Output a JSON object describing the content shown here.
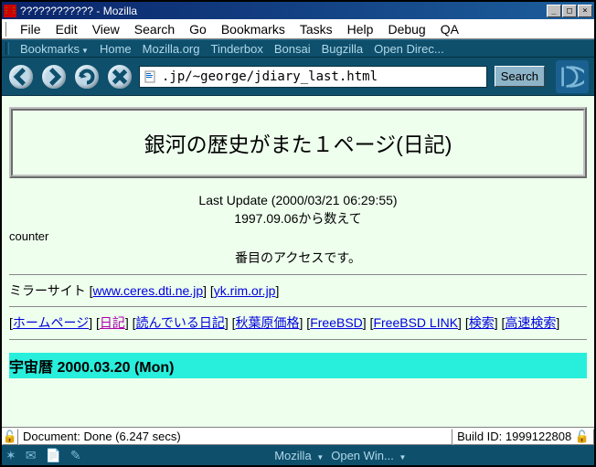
{
  "title": "???????????? - Mozilla",
  "menubar": [
    "File",
    "Edit",
    "View",
    "Search",
    "Go",
    "Bookmarks",
    "Tasks",
    "Help",
    "Debug",
    "QA"
  ],
  "bookmarkbar": [
    {
      "label": "Bookmarks",
      "dropdown": true
    },
    {
      "label": "Home"
    },
    {
      "label": "Mozilla.org"
    },
    {
      "label": "Tinderbox"
    },
    {
      "label": "Bonsai"
    },
    {
      "label": "Bugzilla"
    },
    {
      "label": "Open Direc..."
    }
  ],
  "url": ".jp/~george/jdiary_last.html",
  "search_label": "Search",
  "page": {
    "heading": "銀河の歴史がまた１ページ(日記)",
    "last_update": "Last Update (2000/03/21 06:29:55)",
    "since": "1997.09.06から数えて",
    "counter_label": "counter",
    "access_text": "番目のアクセスです。",
    "mirror_label": "ミラーサイト",
    "mirrors": [
      "www.ceres.dti.ne.jp",
      "yk.rim.or.jp"
    ],
    "navlinks": [
      {
        "t": "ホームページ",
        "v": false
      },
      {
        "t": "日記",
        "v": true
      },
      {
        "t": "読んでいる日記",
        "v": false
      },
      {
        "t": "秋葉原価格",
        "v": false
      },
      {
        "t": "FreeBSD",
        "v": false
      },
      {
        "t": "FreeBSD LINK",
        "v": false
      },
      {
        "t": "検索",
        "v": false
      },
      {
        "t": "高速検索",
        "v": false
      }
    ],
    "diary_date": "宇宙暦 2000.03.20 (Mon)"
  },
  "status": {
    "document": "Document: Done (6.247 secs)",
    "build": "Build ID: 1999122808"
  },
  "taskbar": {
    "center": [
      {
        "label": "Mozilla",
        "dropdown": true
      },
      {
        "label": "Open Win...",
        "dropdown": true
      }
    ]
  }
}
